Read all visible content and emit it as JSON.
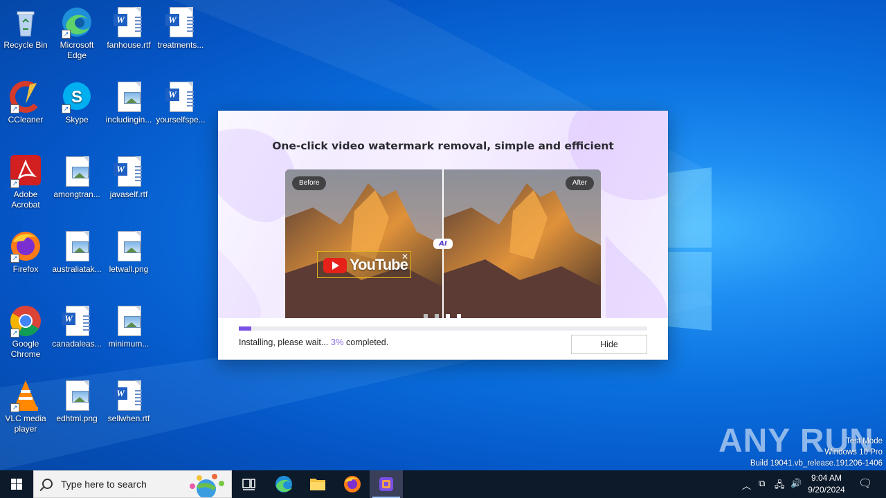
{
  "desktop": {
    "icons": [
      {
        "label": "Recycle Bin",
        "icon": "recycle-bin-icon"
      },
      {
        "label": "Microsoft Edge",
        "icon": "edge-icon"
      },
      {
        "label": "fanhouse.rtf",
        "icon": "word-doc-icon"
      },
      {
        "label": "treatments...",
        "icon": "word-doc-icon"
      },
      {
        "label": "CCleaner",
        "icon": "ccleaner-icon"
      },
      {
        "label": "Skype",
        "icon": "skype-icon"
      },
      {
        "label": "includingin...",
        "icon": "image-file-icon"
      },
      {
        "label": "yourselfspe...",
        "icon": "word-doc-icon"
      },
      {
        "label": "Adobe Acrobat",
        "icon": "acrobat-icon"
      },
      {
        "label": "amongtran...",
        "icon": "image-file-icon"
      },
      {
        "label": "javaself.rtf",
        "icon": "word-doc-icon"
      },
      {
        "label": "Firefox",
        "icon": "firefox-icon"
      },
      {
        "label": "australiatak...",
        "icon": "image-file-icon"
      },
      {
        "label": "letwall.png",
        "icon": "image-file-icon"
      },
      {
        "label": "Google Chrome",
        "icon": "chrome-icon"
      },
      {
        "label": "canadaleas...",
        "icon": "word-doc-icon"
      },
      {
        "label": "minimum...",
        "icon": "image-file-icon"
      },
      {
        "label": "VLC media player",
        "icon": "vlc-icon"
      },
      {
        "label": "edhtml.png",
        "icon": "image-file-icon"
      },
      {
        "label": "sellwhen.rtf",
        "icon": "word-doc-icon"
      }
    ]
  },
  "installer": {
    "headline": "One-click video watermark removal, simple and efficient",
    "before_label": "Before",
    "after_label": "After",
    "ai_badge": "AI",
    "watermark_text": "YouTube",
    "status_prefix": "Installing, please wait...",
    "progress_text": "3%",
    "status_suffix": "completed.",
    "progress_fraction": 0.03,
    "hide_label": "Hide",
    "accent_color": "#7a4fe6"
  },
  "taskbar": {
    "search_placeholder": "Type here to search",
    "time": "9:04 AM",
    "date": "9/20/2024"
  },
  "overlay": {
    "watermark": "ANY RUN",
    "test_mode": "Test Mode",
    "edition": "Windows 10 Pro",
    "build": "Build 19041.vb_release.191206-1406"
  }
}
